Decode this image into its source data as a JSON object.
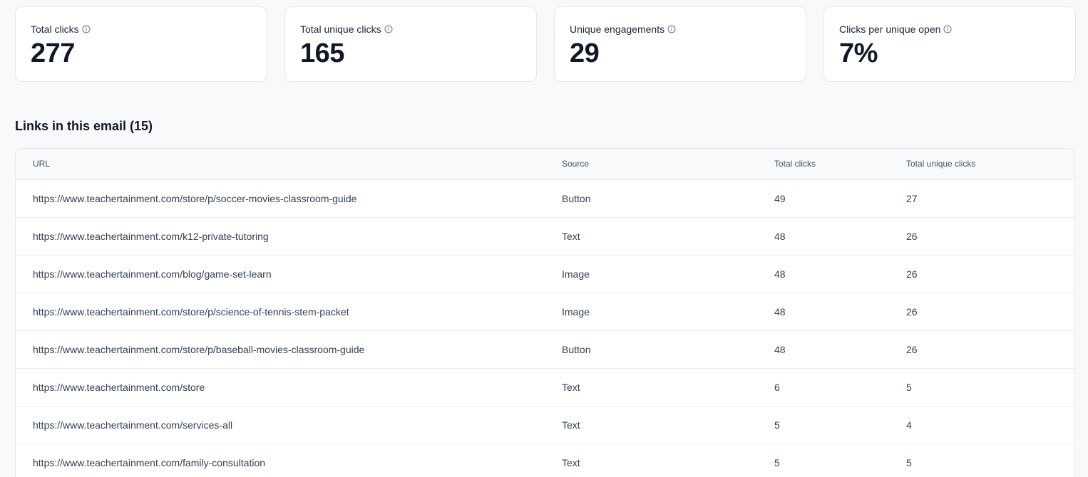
{
  "stats": [
    {
      "label": "Total clicks",
      "value": "277"
    },
    {
      "label": "Total unique clicks",
      "value": "165"
    },
    {
      "label": "Unique engagements",
      "value": "29"
    },
    {
      "label": "Clicks per unique open",
      "value": "7%"
    }
  ],
  "links_section": {
    "title": "Links in this email (15)",
    "columns": {
      "url": "URL",
      "source": "Source",
      "total_clicks": "Total clicks",
      "total_unique_clicks": "Total unique clicks"
    },
    "rows": [
      {
        "url": "https://www.teachertainment.com/store/p/soccer-movies-classroom-guide",
        "source": "Button",
        "total_clicks": "49",
        "unique_clicks": "27"
      },
      {
        "url": "https://www.teachertainment.com/k12-private-tutoring",
        "source": "Text",
        "total_clicks": "48",
        "unique_clicks": "26"
      },
      {
        "url": "https://www.teachertainment.com/blog/game-set-learn",
        "source": "Image",
        "total_clicks": "48",
        "unique_clicks": "26"
      },
      {
        "url": "https://www.teachertainment.com/store/p/science-of-tennis-stem-packet",
        "source": "Image",
        "total_clicks": "48",
        "unique_clicks": "26"
      },
      {
        "url": "https://www.teachertainment.com/store/p/baseball-movies-classroom-guide",
        "source": "Button",
        "total_clicks": "48",
        "unique_clicks": "26"
      },
      {
        "url": "https://www.teachertainment.com/store",
        "source": "Text",
        "total_clicks": "6",
        "unique_clicks": "5"
      },
      {
        "url": "https://www.teachertainment.com/services-all",
        "source": "Text",
        "total_clicks": "5",
        "unique_clicks": "4"
      },
      {
        "url": "https://www.teachertainment.com/family-consultation",
        "source": "Text",
        "total_clicks": "5",
        "unique_clicks": "5"
      }
    ]
  },
  "icons": {
    "info": "info-icon"
  }
}
